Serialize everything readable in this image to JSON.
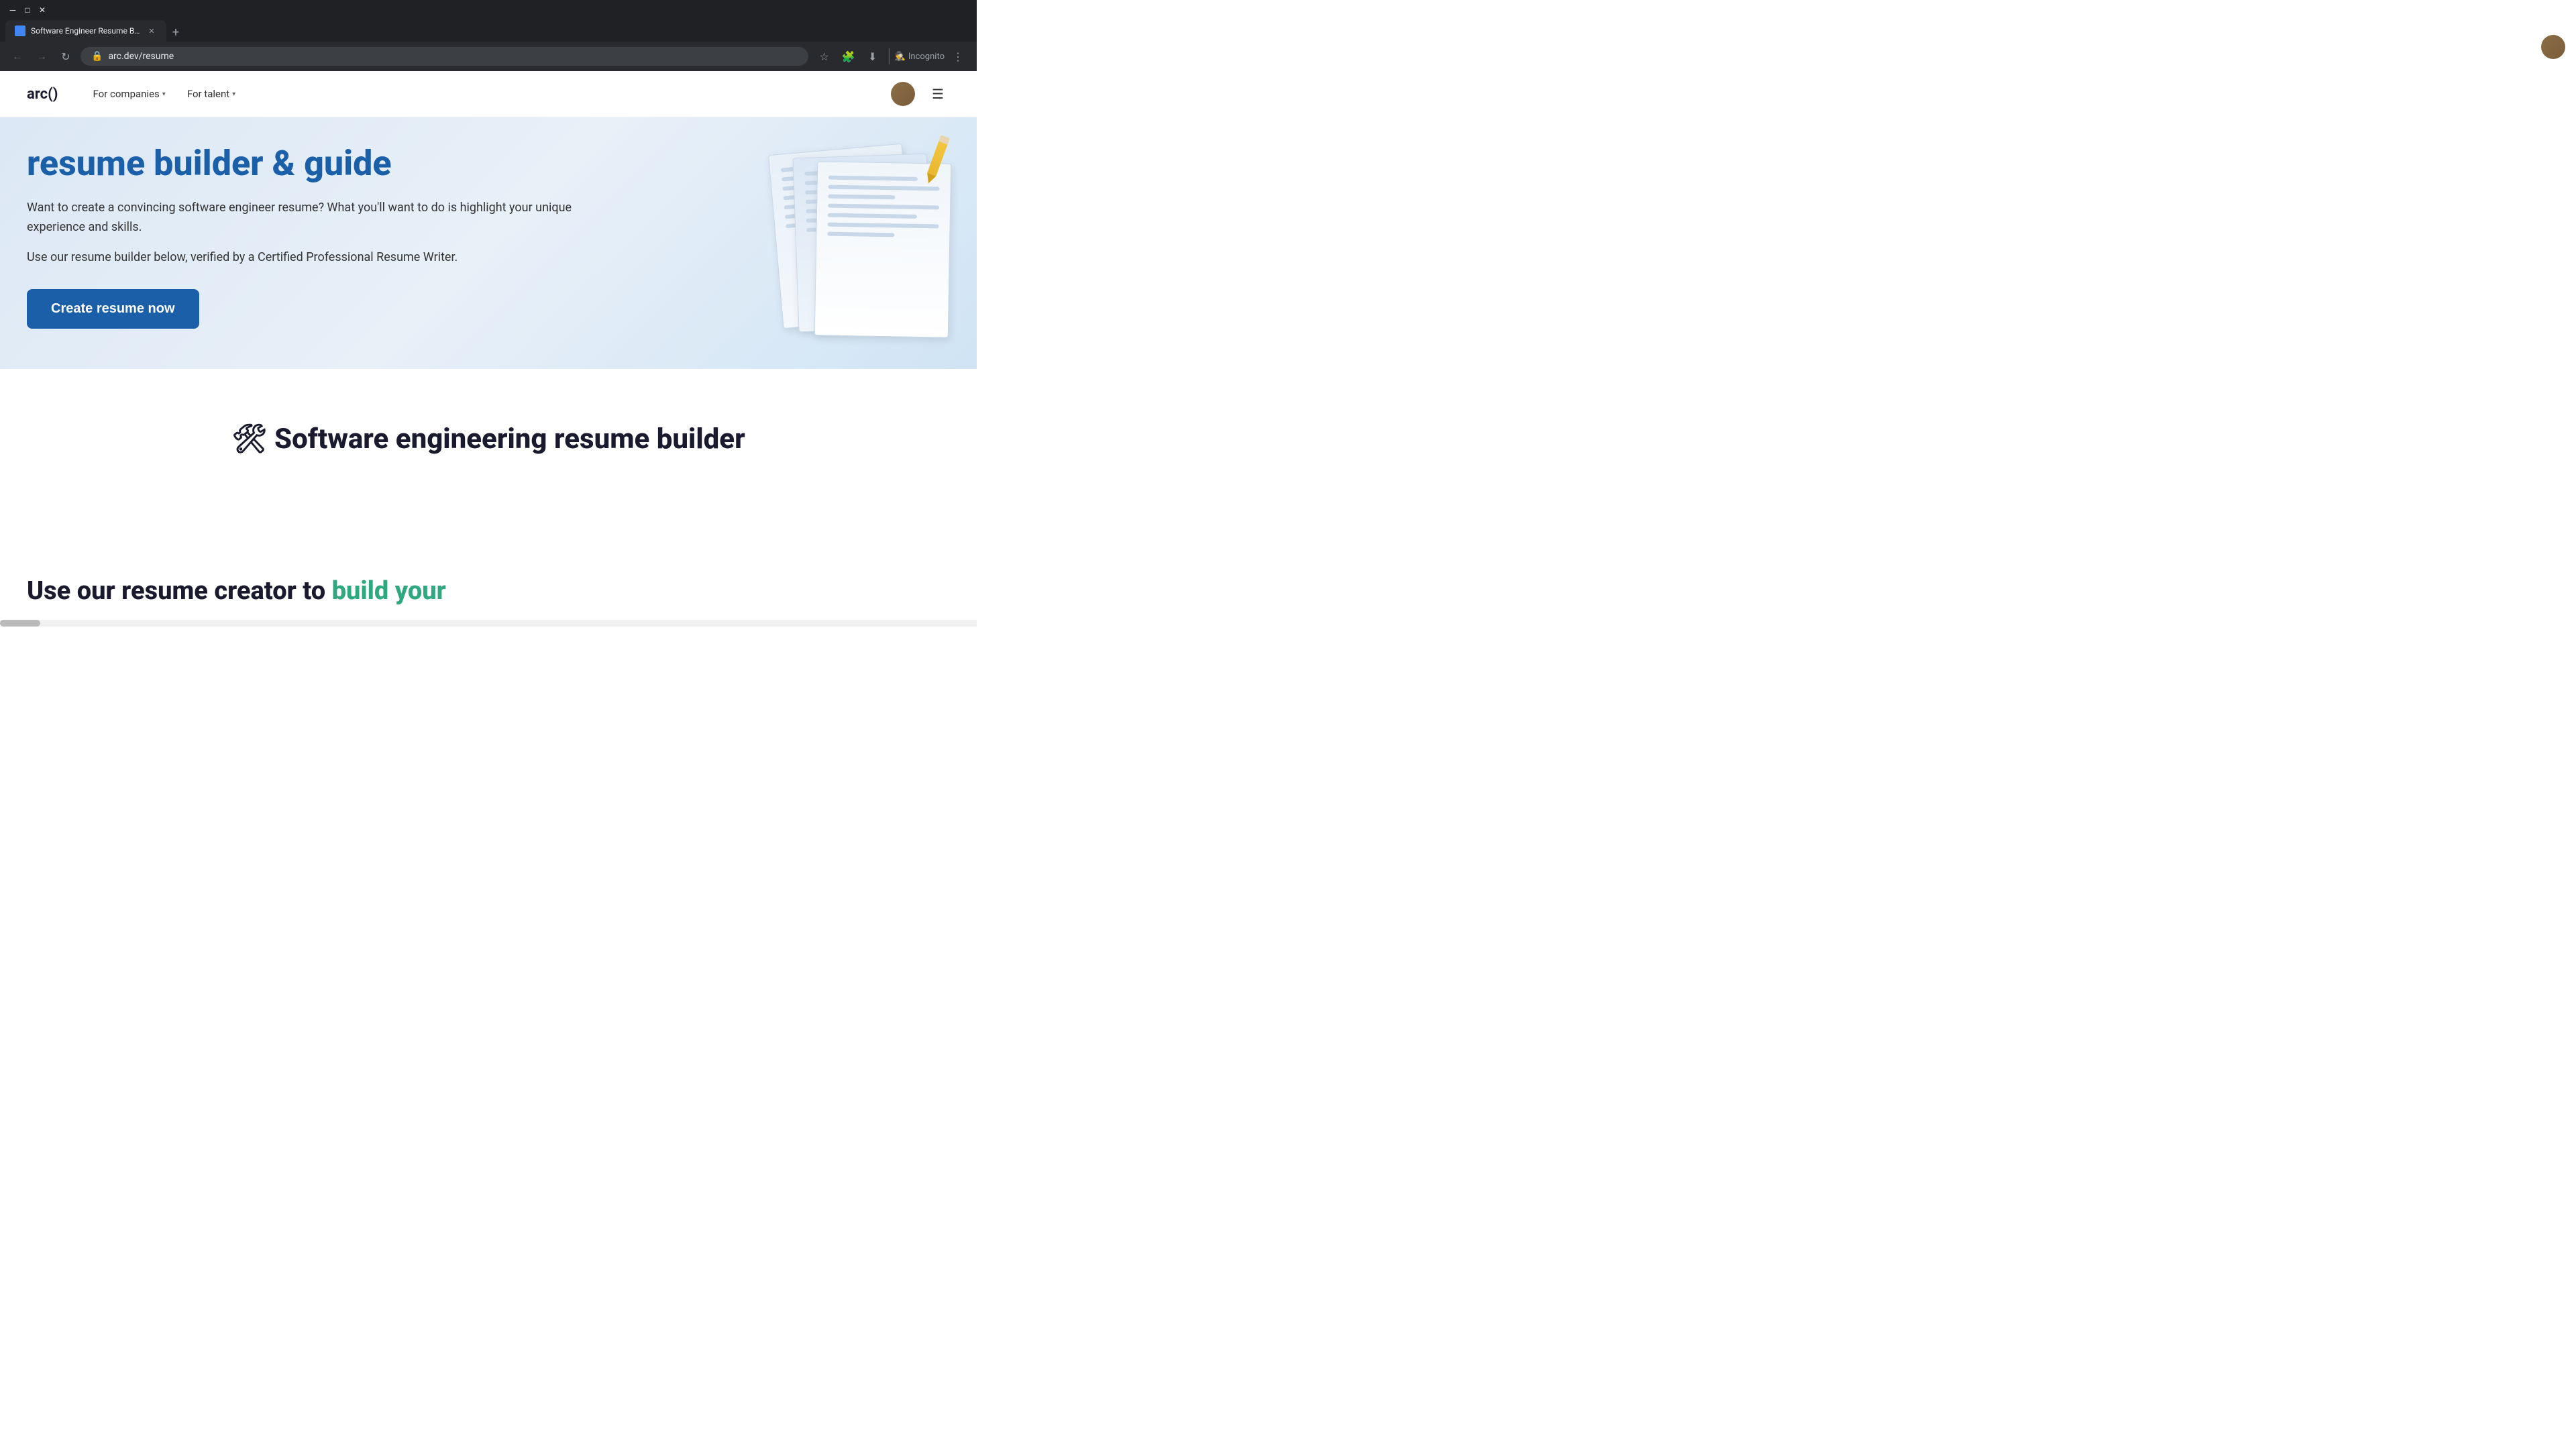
{
  "browser": {
    "tab": {
      "title": "Software Engineer Resume Buil",
      "favicon": "S",
      "active": true
    },
    "address": "arc.dev/resume",
    "incognito_label": "Incognito"
  },
  "nav": {
    "logo": "arc()",
    "links": [
      {
        "label": "For companies",
        "has_dropdown": true
      },
      {
        "label": "For talent",
        "has_dropdown": true
      }
    ]
  },
  "hero": {
    "title": "resume builder & guide",
    "description1": "Want to create a convincing software engineer resume? What you'll want to do is highlight your unique experience and skills.",
    "description2": "Use our resume builder below, verified by a Certified Professional Resume Writer.",
    "cta_button": "Create resume now"
  },
  "section_builder": {
    "title_icon": "🛠",
    "title_text": "Software engineering resume builder"
  },
  "section_use_creator": {
    "text_static": "Use our resume creator to",
    "text_highlight": "build your"
  },
  "cursor": "pointer"
}
